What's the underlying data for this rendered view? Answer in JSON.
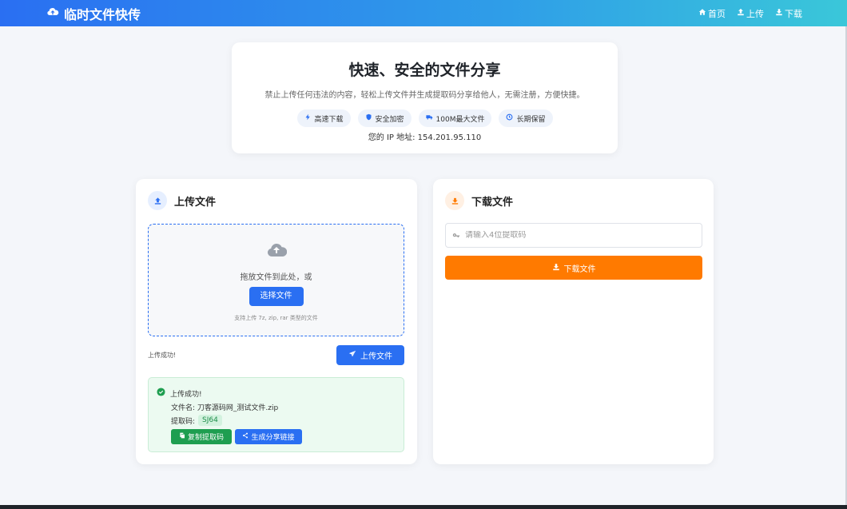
{
  "nav": {
    "brand": "临时文件快传",
    "links": [
      {
        "label": "首页",
        "icon": "home-icon"
      },
      {
        "label": "上传",
        "icon": "upload-icon"
      },
      {
        "label": "下载",
        "icon": "download-icon"
      }
    ]
  },
  "hero": {
    "title": "快速、安全的文件分享",
    "description": "禁止上传任何违法的内容，轻松上传文件并生成提取码分享给他人，无需注册，方便快捷。",
    "features": [
      {
        "label": "高速下载",
        "icon": "bolt-icon"
      },
      {
        "label": "安全加密",
        "icon": "shield-icon"
      },
      {
        "label": "100M最大文件",
        "icon": "truck-icon"
      },
      {
        "label": "长期保留",
        "icon": "clock-icon"
      }
    ],
    "ip_line": "您的 IP 地址: 154.201.95.110"
  },
  "upload": {
    "title": "上传文件",
    "dropzone": {
      "text": "拖放文件到此处，或",
      "choose_label": "选择文件",
      "hint": "支持上传 7z, zip, rar 类型的文件"
    },
    "status_text": "上传成功!",
    "upload_button": "上传文件",
    "result": {
      "message": "上传成功!",
      "file_line": "文件名: 刀客源码网_测试文件.zip",
      "code_label": "提取码:",
      "code_value": "SJ64",
      "copy_button": "复制提取码",
      "share_button": "生成分享链接"
    }
  },
  "download": {
    "title": "下载文件",
    "input_placeholder": "请输入4位提取码",
    "input_value": "",
    "download_button": "下载文件"
  },
  "colors": {
    "primary": "#2a6ff2",
    "accent_orange": "#ff7a00",
    "success": "#1e9e50"
  }
}
